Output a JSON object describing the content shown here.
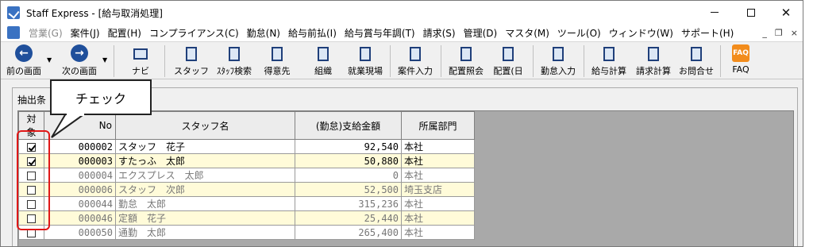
{
  "window": {
    "title": "Staff Express - [給与取消処理]"
  },
  "menu": [
    {
      "label": "営業(G)",
      "disabled": true
    },
    {
      "label": "案件(J)"
    },
    {
      "label": "配置(H)"
    },
    {
      "label": "コンプライアンス(C)"
    },
    {
      "label": "勤怠(N)"
    },
    {
      "label": "給与前払(I)"
    },
    {
      "label": "給与賞与年調(T)"
    },
    {
      "label": "請求(S)"
    },
    {
      "label": "管理(D)"
    },
    {
      "label": "マスタ(M)"
    },
    {
      "label": "ツール(O)"
    },
    {
      "label": "ウィンドウ(W)"
    },
    {
      "label": "サポート(H)"
    }
  ],
  "mdi_buttons": [
    "_",
    "❐",
    "×"
  ],
  "toolbar": {
    "back": "前の画面",
    "next": "次の画面",
    "navi": "ナビ",
    "staff": "スタッフ",
    "staff_search": "ｽﾀｯﾌ検索",
    "client": "得意先",
    "organization": "組織",
    "worksite": "就業現場",
    "case_input": "案件入力",
    "placement_inquiry": "配置照会",
    "placement_day": "配置(日",
    "attendance_input": "勤怠入力",
    "payroll_calc": "給与計算",
    "billing_calc": "請求計算",
    "inquiry": "お問合せ",
    "faq": "FAQ",
    "faq_icon_text": "FAQ"
  },
  "filter": {
    "label": "抽出条"
  },
  "callout": {
    "text": "チェック"
  },
  "table": {
    "headers": [
      "対象",
      "No",
      "スタッフ名",
      "(勤怠)支給金額",
      "所属部門"
    ],
    "rows": [
      {
        "checked": true,
        "no": "000002",
        "name": "スタッフ　花子",
        "amount": "92,540",
        "dept": "本社",
        "grey": false
      },
      {
        "checked": true,
        "no": "000003",
        "name": "すたっふ　太郎",
        "amount": "50,880",
        "dept": "本社",
        "grey": false
      },
      {
        "checked": false,
        "no": "000004",
        "name": "エクスプレス　太郎",
        "amount": "0",
        "dept": "本社",
        "grey": true
      },
      {
        "checked": false,
        "no": "000006",
        "name": "スタッフ　次郎",
        "amount": "52,500",
        "dept": "埼玉支店",
        "grey": true
      },
      {
        "checked": false,
        "no": "000044",
        "name": "勤怠　太郎",
        "amount": "315,236",
        "dept": "本社",
        "grey": true
      },
      {
        "checked": false,
        "no": "000046",
        "name": "定額　花子",
        "amount": "25,440",
        "dept": "本社",
        "grey": true
      },
      {
        "checked": false,
        "no": "000050",
        "name": "通勤　太郎",
        "amount": "265,400",
        "dept": "本社",
        "grey": true
      }
    ]
  },
  "colors": {
    "highlight_outline": "#e01818",
    "even_row": "#fffbd9",
    "grid_background": "#a9a9a9"
  }
}
